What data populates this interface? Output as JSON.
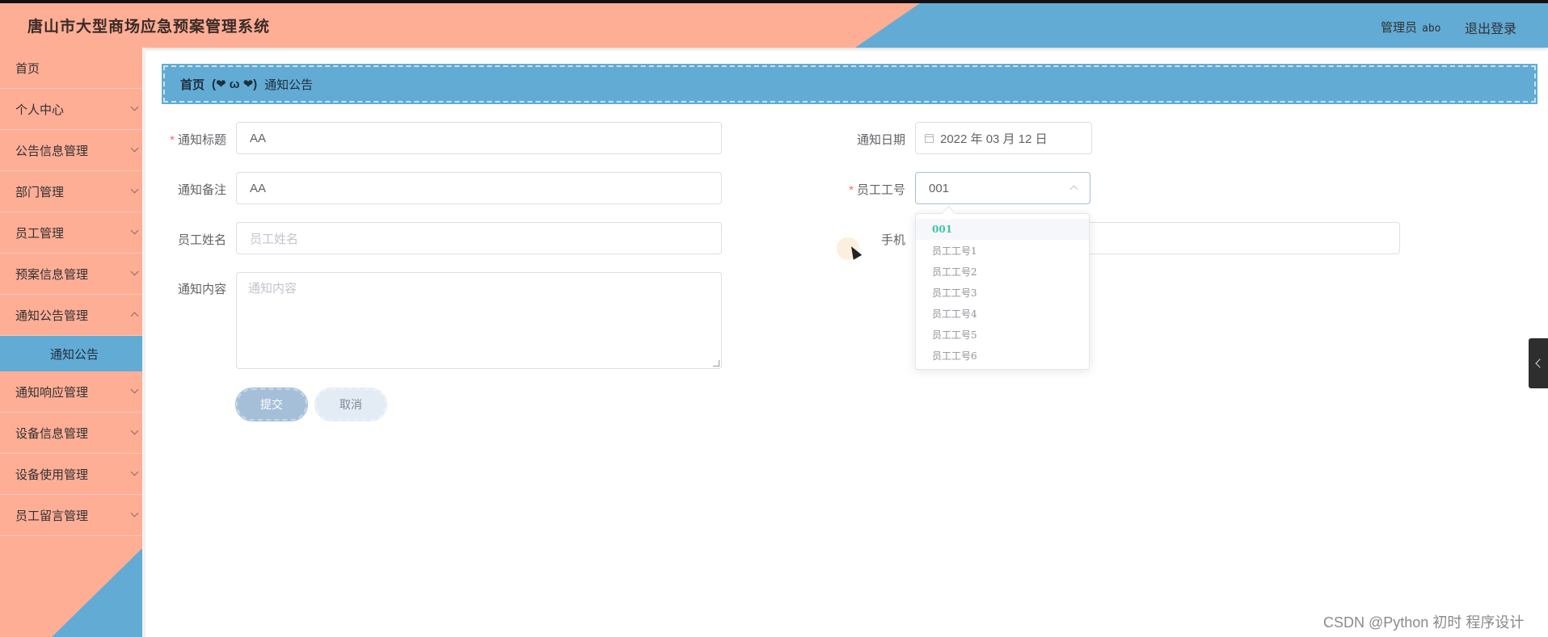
{
  "header": {
    "title": "唐山市大型商场应急预案管理系统",
    "admin_label": "管理员",
    "admin_name": "abo",
    "logout": "退出登录"
  },
  "colors": {
    "peach": "#ffae96",
    "blue": "#62abd4",
    "required": "#f56c6c",
    "selected_option": "#3cc6a7"
  },
  "sidebar": {
    "items": [
      {
        "label": "首页"
      },
      {
        "label": "个人中心"
      },
      {
        "label": "公告信息管理"
      },
      {
        "label": "部门管理"
      },
      {
        "label": "员工管理"
      },
      {
        "label": "预案信息管理"
      },
      {
        "label": "通知公告管理"
      },
      {
        "label": "通知响应管理"
      },
      {
        "label": "设备信息管理"
      },
      {
        "label": "设备使用管理"
      },
      {
        "label": "员工留言管理"
      }
    ],
    "active_sub": "通知公告"
  },
  "breadcrumb": {
    "home": "首页",
    "separator": "(❤ ω ❤)",
    "current": "通知公告"
  },
  "form": {
    "title_label": "通知标题",
    "title_value": "AA",
    "remark_label": "通知备注",
    "remark_value": "AA",
    "name_label": "员工姓名",
    "name_placeholder": "员工姓名",
    "content_label": "通知内容",
    "content_placeholder": "通知内容",
    "date_label": "通知日期",
    "date_value": "2022 年 03 月 12 日",
    "empno_label": "员工工号",
    "empno_value": "001",
    "phone_label": "手机",
    "submit": "提交",
    "cancel": "取消"
  },
  "dropdown": {
    "options": [
      "001",
      "员工工号1",
      "员工工号2",
      "员工工号3",
      "员工工号4",
      "员工工号5",
      "员工工号6"
    ],
    "selected": "001"
  },
  "watermark": "CSDN @Python 初时 程序设计"
}
